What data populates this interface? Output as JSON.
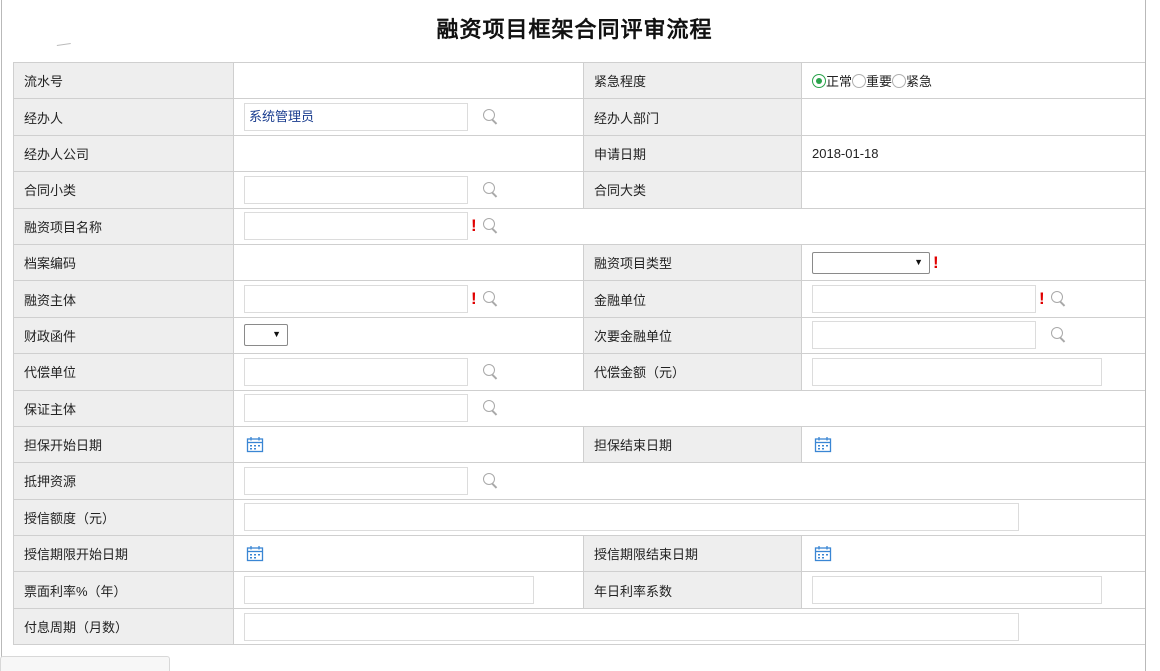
{
  "title": "融资项目框架合同评审流程",
  "rows": [
    {
      "l1": "流水号",
      "l2": "紧急程度"
    },
    {
      "l1": "经办人",
      "v1": "系统管理员",
      "l2": "经办人部门"
    },
    {
      "l1": "经办人公司",
      "l2": "申请日期",
      "v2": "2018-01-18"
    },
    {
      "l1": "合同小类",
      "l2": "合同大类"
    },
    {
      "l1": "融资项目名称"
    },
    {
      "l1": "档案编码",
      "l2": "融资项目类型"
    },
    {
      "l1": "融资主体",
      "l2": "金融单位"
    },
    {
      "l1": "财政函件",
      "l2": "次要金融单位"
    },
    {
      "l1": "代偿单位",
      "l2": "代偿金额（元）"
    },
    {
      "l1": "保证主体"
    },
    {
      "l1": "担保开始日期",
      "l2": "担保结束日期"
    },
    {
      "l1": "抵押资源"
    },
    {
      "l1": "授信额度（元）"
    },
    {
      "l1": "授信期限开始日期",
      "l2": "授信期限结束日期"
    },
    {
      "l1": "票面利率%（年）",
      "l2": "年日利率系数"
    },
    {
      "l1": "付息周期（月数）"
    }
  ],
  "urgency": {
    "options": [
      "正常",
      "重要",
      "紧急"
    ],
    "selected": "正常"
  },
  "colors": {
    "label_bg": "#eeeeee",
    "border": "#cfcfcf",
    "required": "#e00000",
    "calendar_icon": "#3a86d4",
    "radio_selected": "#2aa34b",
    "input_text": "#1a3d8f"
  },
  "icons": [
    "search-icon",
    "calendar-icon",
    "required-icon",
    "dropdown-arrow-icon"
  ]
}
